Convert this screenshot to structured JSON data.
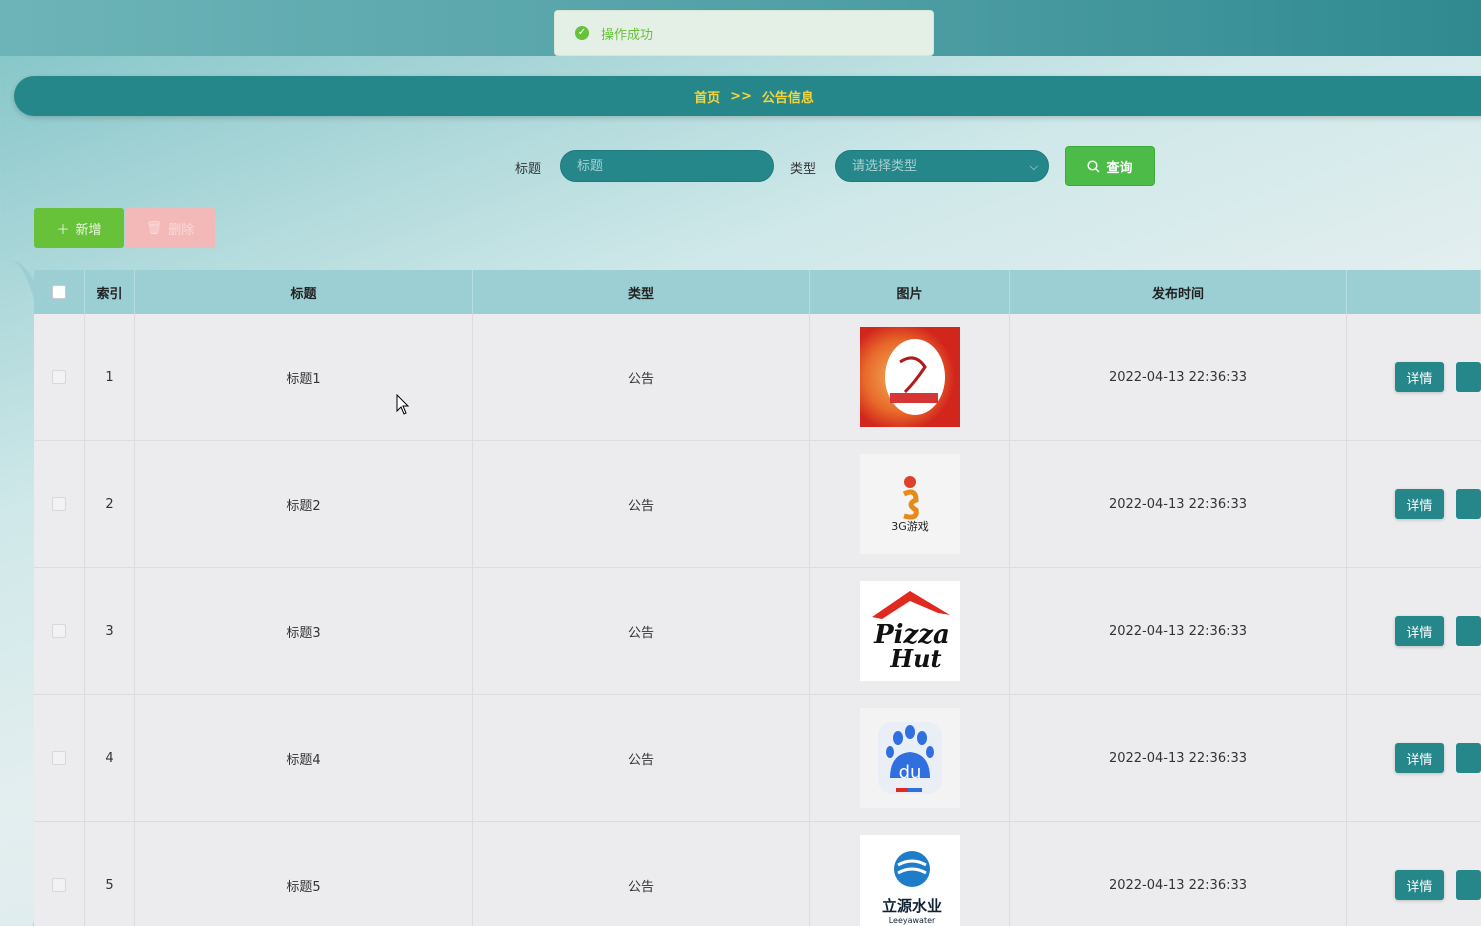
{
  "toast": {
    "message": "操作成功",
    "color": "#67c23a"
  },
  "breadcrumb": {
    "home": "首页",
    "separator": ">>",
    "current": "公告信息"
  },
  "search": {
    "title_label": "标题",
    "title_placeholder": "标题",
    "type_label": "类型",
    "type_placeholder": "请选择类型",
    "query_label": "查询"
  },
  "actions": {
    "add_label": "新增",
    "delete_label": "删除"
  },
  "table": {
    "headers": [
      "索引",
      "标题",
      "类型",
      "图片",
      "发布时间"
    ],
    "rows": [
      {
        "index": "1",
        "title": "标题1",
        "type": "公告",
        "image": "food-logo",
        "time": "2022-04-13 22:36:33",
        "detail": "详情"
      },
      {
        "index": "2",
        "title": "标题2",
        "type": "公告",
        "image": "3g-game-logo",
        "time": "2022-04-13 22:36:33",
        "detail": "详情"
      },
      {
        "index": "3",
        "title": "标题3",
        "type": "公告",
        "image": "pizza-hut-logo",
        "time": "2022-04-13 22:36:33",
        "detail": "详情"
      },
      {
        "index": "4",
        "title": "标题4",
        "type": "公告",
        "image": "baidu-logo",
        "time": "2022-04-13 22:36:33",
        "detail": "详情"
      },
      {
        "index": "5",
        "title": "标题5",
        "type": "公告",
        "image": "water-company-logo",
        "time": "2022-04-13 22:36:33",
        "detail": "详情"
      }
    ]
  },
  "logos": {
    "logo3_line1": "Pizza",
    "logo3_line2": "Hut",
    "logo4_text": "du",
    "logo5_cn": "立源水业",
    "logo5_en": "Leeyawater",
    "logo2_text": "3G游戏"
  },
  "colors": {
    "primary": "#26878b",
    "success": "#67c23a",
    "danger_disabled": "#f3b8b8",
    "breadcrumb_text": "#f5d53a",
    "header_bg": "#9ccfd4"
  }
}
